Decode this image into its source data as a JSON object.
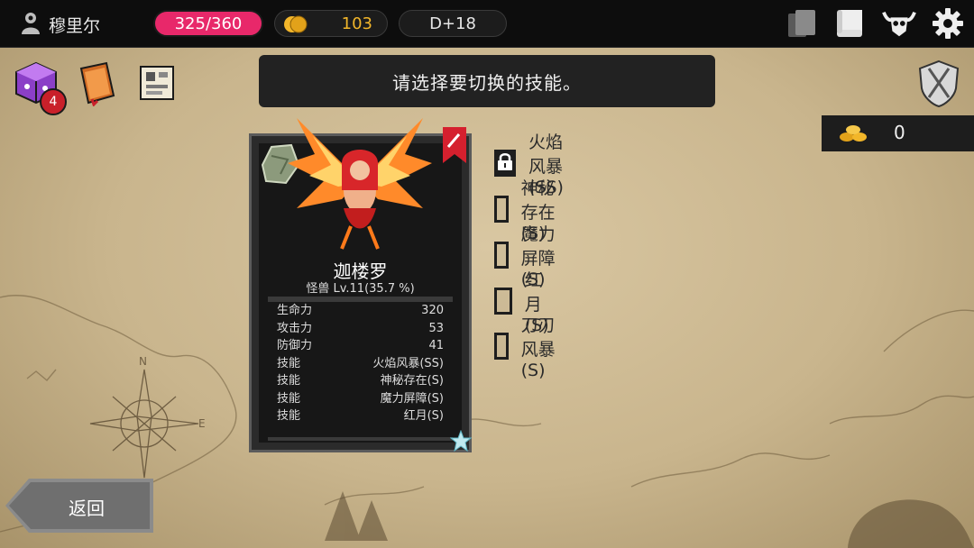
{
  "player": {
    "name": "穆里尔"
  },
  "hp": "325/360",
  "gold": "103",
  "day": "D+18",
  "prompt": "请选择要切换的技能。",
  "shortcuts": {
    "badge_count": "4"
  },
  "resource": {
    "value": "0"
  },
  "monster": {
    "name": "迦楼罗",
    "subtitle": "怪兽 Lv.11(35.7 %)",
    "stats": [
      {
        "label": "生命力",
        "value": "320"
      },
      {
        "label": "攻击力",
        "value": "53"
      },
      {
        "label": "防御力",
        "value": "41"
      },
      {
        "label": "技能",
        "value": "火焰风暴(SS)"
      },
      {
        "label": "技能",
        "value": "神秘存在(S)"
      },
      {
        "label": "技能",
        "value": "魔力屏障(S)"
      },
      {
        "label": "技能",
        "value": "红月(S)"
      }
    ]
  },
  "skills": [
    {
      "label": "火焰风暴(SS)",
      "locked": true
    },
    {
      "label": "神秘存在(S)",
      "locked": false
    },
    {
      "label": "魔力屏障(S)",
      "locked": false
    },
    {
      "label": "红月(S)",
      "locked": false
    },
    {
      "label": "刀刃风暴(S)",
      "locked": false
    }
  ],
  "back_label": "返回",
  "colors": {
    "hp": "#e8286a",
    "gold": "#f2b62a",
    "badge": "#c9202a",
    "panel": "#222222"
  },
  "icons": [
    "player-icon",
    "coin-icon",
    "cards-icon",
    "scroll-icon",
    "horned-skull-icon",
    "gear-icon",
    "dice-box-icon",
    "spellbook-icon",
    "map-scroll-icon",
    "shield-swords-icon",
    "gold-pile-icon",
    "lock-icon",
    "star-icon",
    "stone-icon",
    "bookmark-icon"
  ]
}
